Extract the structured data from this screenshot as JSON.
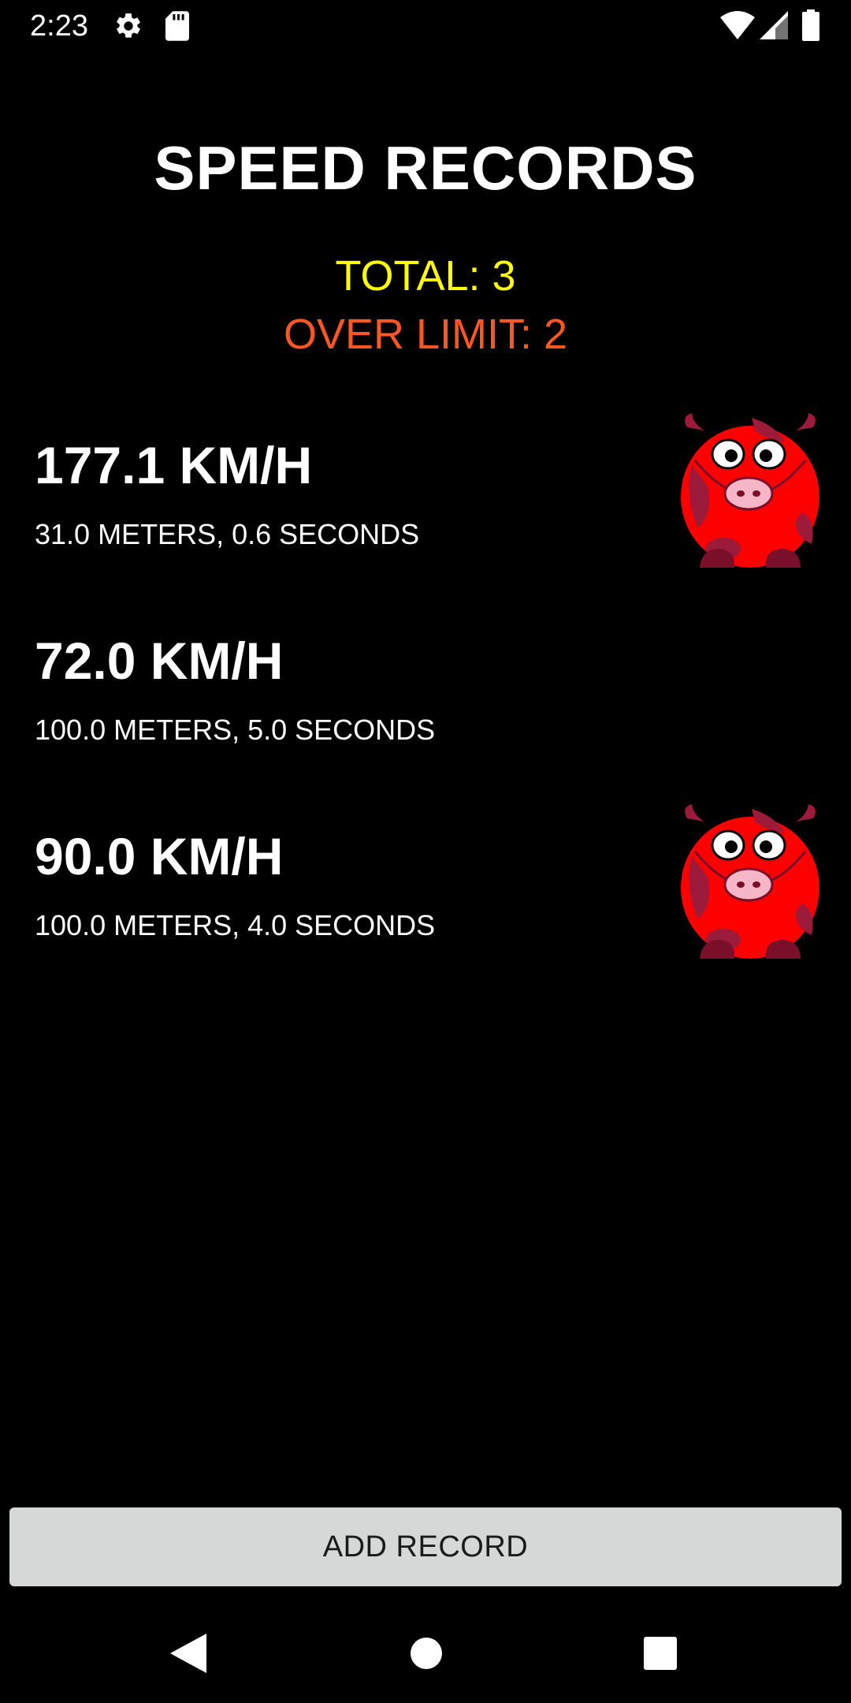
{
  "status_bar": {
    "time": "2:23",
    "icons": [
      "gear-icon",
      "sd-card-icon",
      "wifi-icon",
      "signal-icon",
      "battery-icon"
    ]
  },
  "header": {
    "title": "SPEED RECORDS",
    "total": "TOTAL: 3",
    "over_limit": "OVER LIMIT: 2"
  },
  "colors": {
    "background": "#000000",
    "total": "#ffff00",
    "over_limit": "#ff5722",
    "cow": "#ff0000",
    "button": "#d6d7d7"
  },
  "records": [
    {
      "speed": "177.1 KM/H",
      "detail": "31.0 METERS, 0.6 SECONDS",
      "over_limit": true,
      "icon": "cow-icon"
    },
    {
      "speed": "72.0 KM/H",
      "detail": "100.0 METERS, 5.0 SECONDS",
      "over_limit": false,
      "icon": ""
    },
    {
      "speed": "90.0 KM/H",
      "detail": "100.0 METERS, 4.0 SECONDS",
      "over_limit": true,
      "icon": "cow-icon"
    }
  ],
  "actions": {
    "add_record": "ADD RECORD"
  },
  "nav": {
    "icons": [
      "back-icon",
      "home-icon",
      "recents-icon"
    ]
  }
}
